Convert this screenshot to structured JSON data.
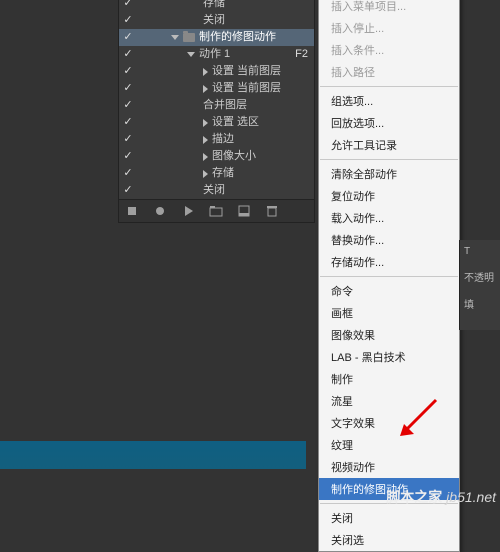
{
  "actions": {
    "group": {
      "label": "制作的修图动作"
    },
    "action1": {
      "label": "动作 1",
      "shortcut": "F2"
    },
    "steps": [
      {
        "label": "设置 当前图层"
      },
      {
        "label": "设置 当前图层"
      },
      {
        "label": "合并图层"
      },
      {
        "label": "设置 选区"
      },
      {
        "label": "描边"
      },
      {
        "label": "图像大小"
      },
      {
        "label": "存储"
      },
      {
        "label": "关闭"
      }
    ],
    "above": [
      {
        "label": "存储"
      },
      {
        "label": "关闭"
      }
    ]
  },
  "menu": {
    "g1": [
      {
        "label": "插入菜单项目...",
        "disabled": true
      },
      {
        "label": "插入停止...",
        "disabled": true
      },
      {
        "label": "插入条件...",
        "disabled": true
      },
      {
        "label": "插入路径",
        "disabled": true
      }
    ],
    "g2": [
      {
        "label": "组选项..."
      },
      {
        "label": "回放选项..."
      },
      {
        "label": "允许工具记录"
      }
    ],
    "g3": [
      {
        "label": "清除全部动作"
      },
      {
        "label": "复位动作"
      },
      {
        "label": "载入动作..."
      },
      {
        "label": "替换动作..."
      },
      {
        "label": "存储动作..."
      }
    ],
    "g4": [
      {
        "label": "命令"
      },
      {
        "label": "画框"
      },
      {
        "label": "图像效果"
      },
      {
        "label": "LAB - 黑白技术"
      },
      {
        "label": "制作"
      },
      {
        "label": "流星"
      },
      {
        "label": "文字效果"
      },
      {
        "label": "纹理"
      },
      {
        "label": "视频动作"
      },
      {
        "label": "制作的修图动作",
        "hl": true
      }
    ],
    "g5": [
      {
        "label": "关闭"
      },
      {
        "label": "关闭选"
      }
    ]
  },
  "rpanel": {
    "a": "T",
    "b": "不透明",
    "c": "填"
  },
  "watermark": {
    "site": "jb51.net",
    "brand": "脚本之家"
  },
  "icons": {
    "check": "✓"
  }
}
